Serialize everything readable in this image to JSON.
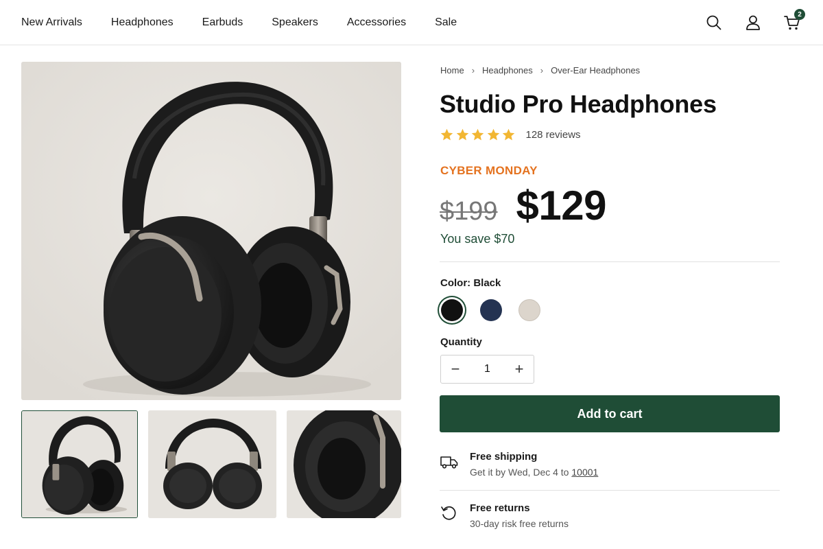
{
  "nav": {
    "links": [
      "New Arrivals",
      "Headphones",
      "Earbuds",
      "Speakers",
      "Accessories",
      "Sale"
    ],
    "icons": [
      "search-icon",
      "account-icon",
      "cart-icon"
    ],
    "cart_count": "2"
  },
  "gallery": {
    "main_image": "studio-pro-headphones-angled",
    "thumbnails": [
      "headphones-angled",
      "headphones-folded-top",
      "ear-cushion-closeup"
    ],
    "active_thumbnail": 0
  },
  "breadcrumb": {
    "items": [
      "Home",
      "Headphones",
      "Over-Ear Headphones"
    ],
    "separator_icon": "chevron-right-icon"
  },
  "product": {
    "title": "Studio Pro Headphones",
    "rating": {
      "stars": 5,
      "max": 5,
      "review_count": "128 reviews"
    },
    "promo_label": "CYBER MONDAY",
    "old_price": "$199",
    "new_price": "$129",
    "savings": "You save $70"
  },
  "options": {
    "color_label": "Color: Black",
    "colors": [
      {
        "name": "Black",
        "hex": "#111111",
        "selected": true
      },
      {
        "name": "Navy",
        "hex": "#243352",
        "selected": false
      },
      {
        "name": "Cream",
        "hex": "#dcd5cc",
        "selected": false
      }
    ],
    "quantity_label": "Quantity",
    "quantity": "1",
    "decrement_symbol": "−",
    "increment_symbol": "+"
  },
  "cta": {
    "add_to_cart": "Add to cart"
  },
  "perks": {
    "shipping": {
      "icon": "truck-icon",
      "title": "Free shipping",
      "sub_prefix": "Get it by Wed, Dec 4 to ",
      "zip": "10001"
    },
    "returns": {
      "icon": "return-icon",
      "title": "Free returns",
      "sub": "30-day risk free returns"
    }
  },
  "colors": {
    "brand": "#1f4d36",
    "promo": "#e4721f",
    "star": "#f2b632"
  }
}
